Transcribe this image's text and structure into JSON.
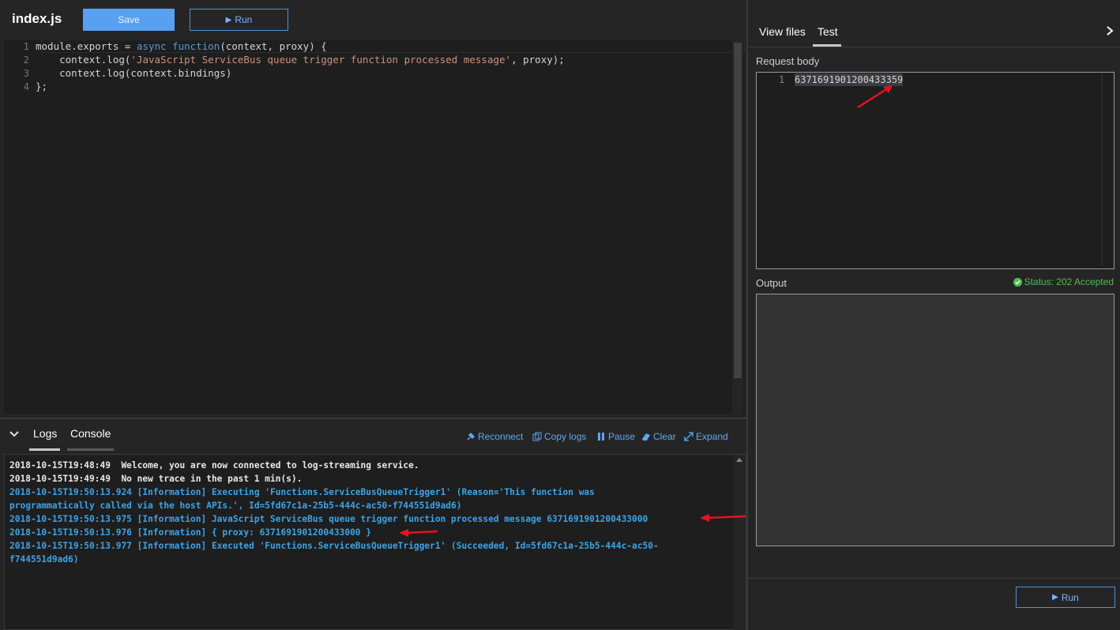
{
  "editor": {
    "file_title": "index.js",
    "save_label": "Save",
    "run_label": "Run",
    "line_numbers": [
      "1",
      "2",
      "3",
      "4"
    ],
    "line1_parts": [
      "module.exports = ",
      "async",
      " ",
      "function",
      "(context, proxy) {"
    ],
    "line2_parts": [
      "    context.log(",
      "'JavaScript ServiceBus queue trigger function processed message'",
      ", proxy);"
    ],
    "line3": "    context.log(context.bindings)",
    "line4": "};"
  },
  "logs_panel": {
    "tab_logs": "Logs",
    "tab_console": "Console",
    "reconnect": "Reconnect",
    "copy_logs": "Copy logs",
    "pause": "Pause",
    "clear": "Clear",
    "expand": "Expand",
    "lines": [
      "2018-10-15T19:48:49  Welcome, you are now connected to log-streaming service.",
      "2018-10-15T19:49:49  No new trace in the past 1 min(s).",
      "2018-10-15T19:50:13.924 [Information] Executing 'Functions.ServiceBusQueueTrigger1' (Reason='This function was",
      "programmatically called via the host APIs.', Id=5fd67c1a-25b5-444c-ac50-f744551d9ad6)",
      "2018-10-15T19:50:13.975 [Information] JavaScript ServiceBus queue trigger function processed message 6371691901200433000",
      "2018-10-15T19:50:13.976 [Information] { proxy: 6371691901200433000 }",
      "2018-10-15T19:50:13.977 [Information] Executed 'Functions.ServiceBusQueueTrigger1' (Succeeded, Id=5fd67c1a-25b5-444c-ac50-",
      "f744551d9ad6)"
    ]
  },
  "test_panel": {
    "tab_view_files": "View files",
    "tab_test": "Test",
    "request_body_label": "Request body",
    "request_line_number": "1",
    "request_body_value": "6371691901200433359",
    "output_label": "Output",
    "status_text": "Status: 202 Accepted",
    "run_label": "Run"
  },
  "colors": {
    "accent": "#5aa0f0",
    "log_info": "#3da3e6",
    "status_ok": "#57b954",
    "annotation_arrow": "#e81123"
  }
}
